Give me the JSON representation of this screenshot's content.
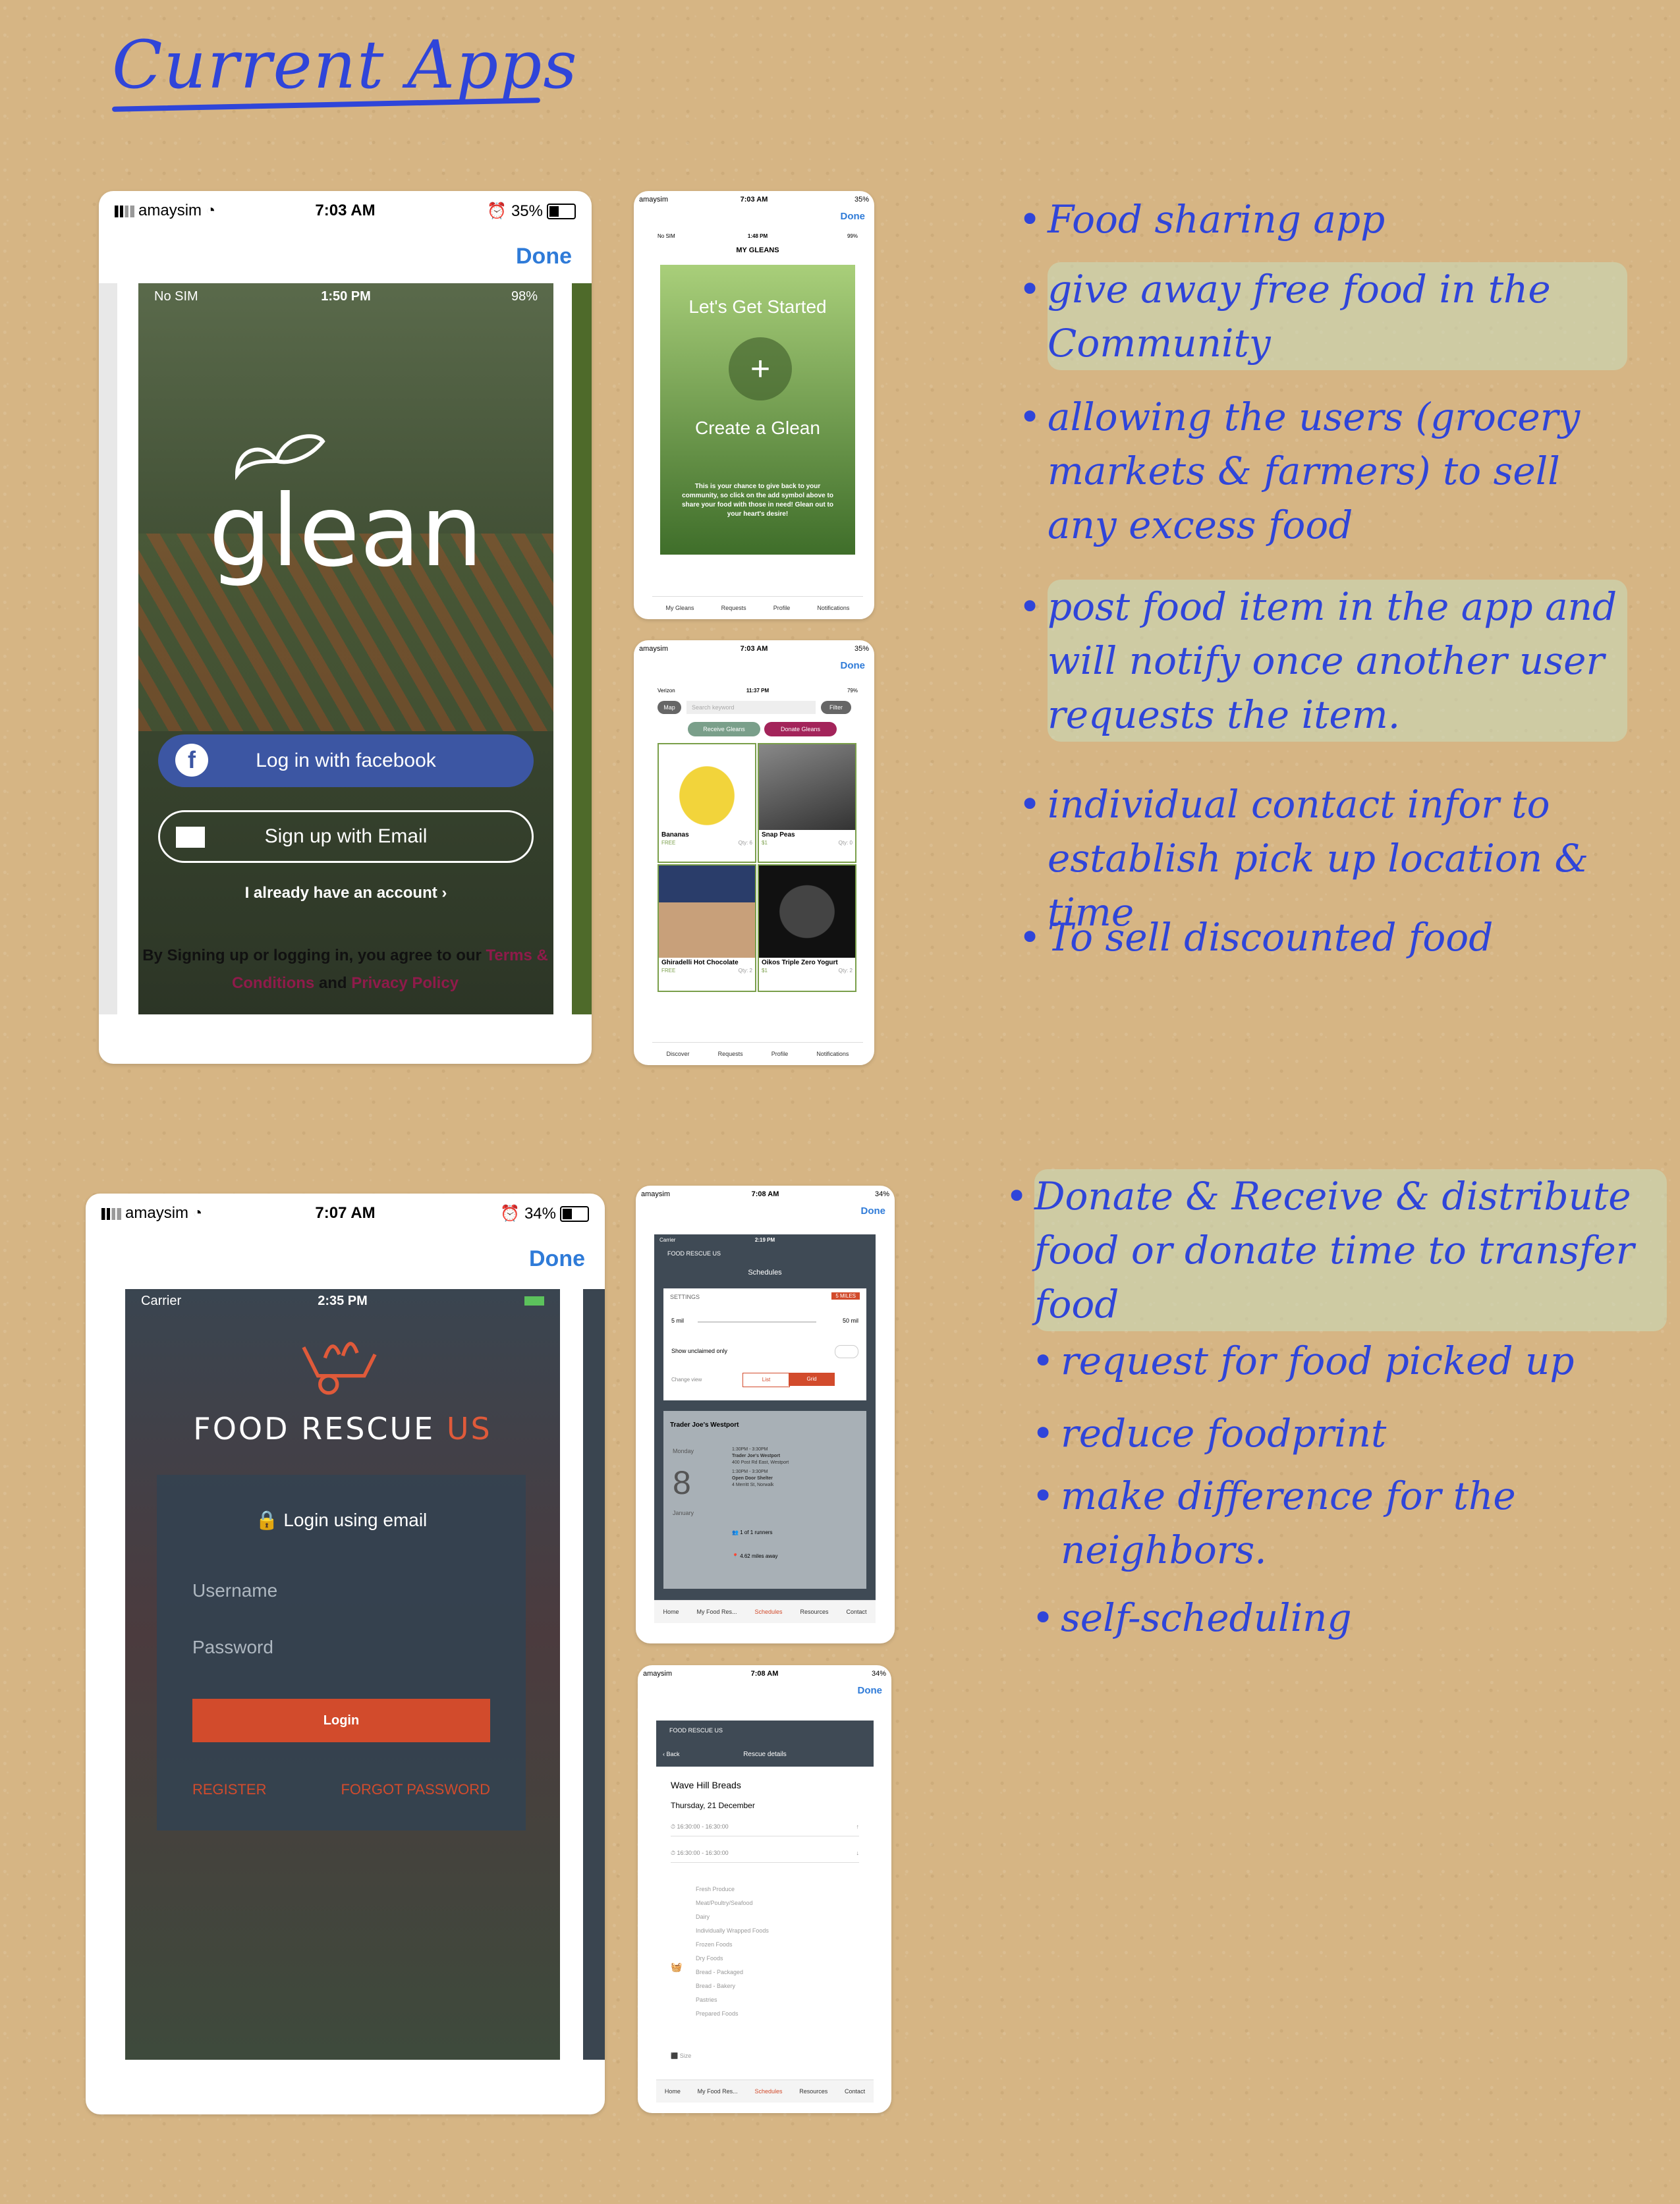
{
  "page_title": "Current Apps",
  "glean_main": {
    "carrier": "amaysim",
    "time": "7:03 AM",
    "battery": "35%",
    "done_label": "Done",
    "inner_status": {
      "carrier": "No SIM",
      "time": "1:50 PM",
      "battery": "98%"
    },
    "logo": "glean",
    "facebook_label": "Log in with facebook",
    "email_label": "Sign up with Email",
    "already_label": "I already have an account",
    "terms_prefix": "By Signing up or logging in, you agree to our",
    "terms_link": "Terms & Conditions",
    "terms_and": "and",
    "privacy_link": "Privacy Policy"
  },
  "glean_create": {
    "carrier": "amaysim",
    "time": "7:03 AM",
    "battery": "35%",
    "done_label": "Done",
    "inner_status": {
      "carrier": "No SIM",
      "time": "1:48 PM",
      "battery": "99%"
    },
    "header": "MY GLEANS",
    "start_label": "Let's Get Started",
    "create_label": "Create a Glean",
    "description": "This is your chance to give back to your community, so click on the add symbol above to share your food with those in need! Glean out to your heart's desire!",
    "tabs": [
      "My Gleans",
      "Requests",
      "Profile",
      "Notifications"
    ]
  },
  "glean_discover": {
    "carrier": "amaysim",
    "time": "7:03 AM",
    "battery": "35%",
    "done_label": "Done",
    "inner_status": {
      "carrier": "Verizon",
      "time": "11:37 PM",
      "battery": "79%"
    },
    "map_label": "Map",
    "search_placeholder": "Search keyword",
    "filter_label": "Filter",
    "receive_label": "Receive Gleans",
    "donate_label": "Donate Gleans",
    "items": [
      {
        "name": "Bananas",
        "price": "FREE",
        "qty": "Qty: 6"
      },
      {
        "name": "Snap Peas",
        "price": "$1",
        "qty": "Qty: 0"
      },
      {
        "name": "Ghiradelli Hot Chocolate",
        "price": "FREE",
        "qty": "Qty: 2"
      },
      {
        "name": "Oikos Triple Zero Yogurt",
        "price": "$1",
        "qty": "Qty: 2"
      }
    ],
    "tabs": [
      "Discover",
      "Requests",
      "Profile",
      "Notifications"
    ]
  },
  "notes_glean": [
    "Food sharing app",
    "give away free food in the Community",
    "allowing the users (grocery markets & farmers) to sell any excess food",
    "post food item in the app and will notify once another user requests the item.",
    "individual contact infor to establish pick up location & time",
    "To sell discounted food"
  ],
  "fr_main": {
    "carrier": "amaysim",
    "time": "7:07 AM",
    "battery": "34%",
    "done_label": "Done",
    "inner_status": {
      "carrier": "Carrier",
      "time": "2:35 PM"
    },
    "brand_prefix": "FOOD RESCUE",
    "brand_suffix": "US",
    "login_heading": "Login using email",
    "username_placeholder": "Username",
    "password_placeholder": "Password",
    "login_button": "Login",
    "register_link": "REGISTER",
    "forgot_link": "FORGOT PASSWORD"
  },
  "fr_schedules": {
    "carrier": "amaysim",
    "time": "7:08 AM",
    "battery": "34%",
    "done_label": "Done",
    "inner_status": {
      "carrier": "Carrier",
      "time": "2:19 PM"
    },
    "brand": "FOOD RESCUE US",
    "header": "Schedules",
    "settings_label": "SETTINGS",
    "miles_badge": "5 MILES",
    "min_label": "5 mil",
    "max_label": "50 mil",
    "unclaimed_label": "Show unclaimed only",
    "change_view_label": "Change view",
    "list_label": "List",
    "grid_label": "Grid",
    "location": "Trader Joe's Westport",
    "day": "Monday",
    "date_num": "8",
    "month": "January",
    "slot1_time": "1:30PM - 3:30PM",
    "slot1_name": "Trader Joe's Westport",
    "slot1_addr": "400 Post Rd East, Westport",
    "slot2_time": "1:30PM - 3:30PM",
    "slot2_name": "Open Door Shelter",
    "slot2_addr": "4 Merritt St, Norwalk",
    "runners": "1 of 1 runners",
    "distance": "4.62 miles away",
    "tabs": [
      "Home",
      "My Food Res...",
      "Schedules",
      "Resources",
      "Contact"
    ]
  },
  "fr_details": {
    "carrier": "amaysim",
    "time": "7:08 AM",
    "battery": "34%",
    "done_label": "Done",
    "inner_status": {
      "carrier": "Carrier",
      "time": "2:43 PM"
    },
    "brand": "FOOD RESCUE US",
    "back_label": "Back",
    "header": "Rescue details",
    "place": "Wave Hill Breads",
    "date": "Thursday, 21 December",
    "time1": "16:30:00 - 16:30:00",
    "time2": "16:30:00 - 16:30:00",
    "categories": [
      "Fresh Produce",
      "Meat/Poultry/Seafood",
      "Dairy",
      "Individually Wrapped Foods",
      "Frozen Foods",
      "Dry Foods",
      "Bread - Packaged",
      "Bread - Bakery",
      "Pastries",
      "Prepared Foods"
    ],
    "size_label": "Size",
    "tabs": [
      "Home",
      "My Food Res...",
      "Schedules",
      "Resources",
      "Contact"
    ]
  },
  "notes_fr": [
    "Donate & Receive & distribute food or donate time to transfer food",
    "request for food picked up",
    "reduce foodprint",
    "make difference for the neighbors.",
    "self-scheduling"
  ],
  "colors": {
    "ink": "#2f45d9",
    "ios_blue": "#2f7bd8",
    "facebook": "#3c56a3",
    "fr_orange": "#d24b2c",
    "glean_green": "#7a9f4a"
  }
}
